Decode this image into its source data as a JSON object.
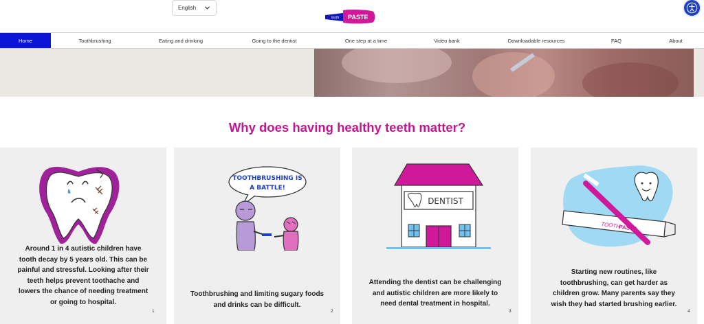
{
  "header": {
    "language": "English",
    "logo_text_small": "tooth",
    "logo_text_big": "PASTE"
  },
  "nav": [
    {
      "label": "Home",
      "active": true
    },
    {
      "label": "Toothbrushing",
      "active": false
    },
    {
      "label": "Eating and drinking",
      "active": false
    },
    {
      "label": "Going to the dentist",
      "active": false
    },
    {
      "label": "One step at a time",
      "active": false
    },
    {
      "label": "Video bank",
      "active": false
    },
    {
      "label": "Downloadable resources",
      "active": false
    },
    {
      "label": "FAQ",
      "active": false
    },
    {
      "label": "About",
      "active": false
    }
  ],
  "section": {
    "title": "Why does having healthy teeth matter?"
  },
  "cards": [
    {
      "lines": [
        "Around 1 in 4 autistic children have",
        "tooth decay by 5 years old. This can be",
        "painful and stressful. Looking after their",
        "teeth helps prevent toothache and",
        "lowers the chance of needing treatment",
        "or going to hospital."
      ],
      "number": "1"
    },
    {
      "lines": [
        "Toothbrushing and limiting sugary foods",
        "and drinks can be difficult."
      ],
      "number": "2",
      "bubble_line1": "TOOTHBRUSHING IS",
      "bubble_line2": "A BATTLE!"
    },
    {
      "lines": [
        "Attending the dentist can be challenging",
        "and autistic children are more likely to",
        "need dental treatment in hospital."
      ],
      "number": "3",
      "sign": "DENTIST"
    },
    {
      "lines": [
        "Starting new routines, like",
        "toothbrushing, can get harder as",
        "children grow. Many parents say they",
        "wish they had started brushing earlier."
      ],
      "number": "4",
      "tube_label_a": "TOOTH",
      "tube_label_b": "PASTE"
    }
  ],
  "colors": {
    "brand_magenta": "#c0168f",
    "nav_active": "#0a15d6",
    "accessibility_blue": "#1e3fbf",
    "card_bg": "#efefef"
  },
  "icons": {
    "language_chevron": "chevron-down-icon",
    "accessibility": "accessibility-icon"
  }
}
